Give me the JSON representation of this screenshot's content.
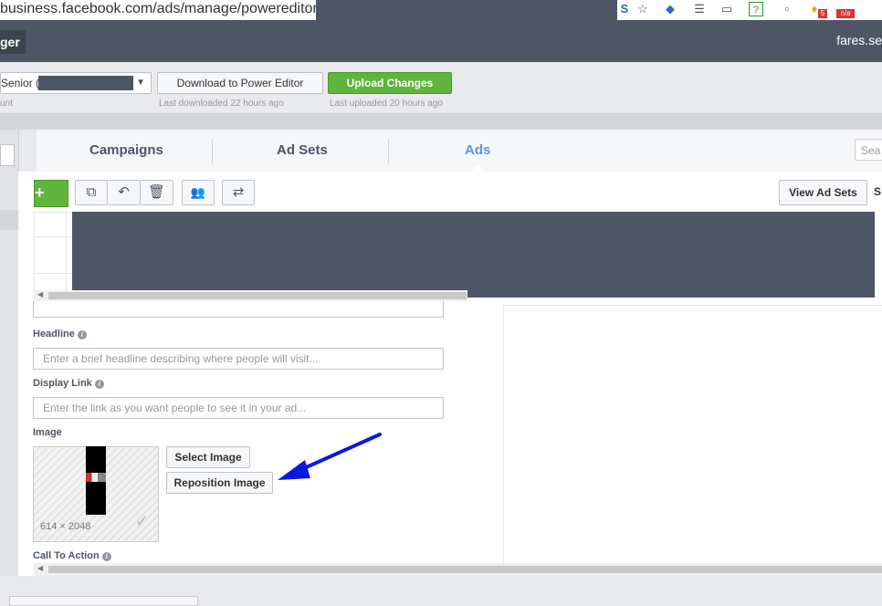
{
  "browser": {
    "url": "business.facebook.com/ads/manage/powereditor/",
    "toolbar_icons": [
      "s-icon",
      "star-icon",
      "puzzle-icon",
      "lines-icon",
      "minus-icon",
      "help-icon",
      "page-icon",
      "bulb-icon",
      "badge-icon"
    ],
    "badge_count": "5",
    "badge_na": "n/a"
  },
  "app": {
    "title_fragment": "ger",
    "user_fragment": "fares.se"
  },
  "toolbar": {
    "account_label": "Senior (",
    "account_sub": "unt",
    "download_label": "Download to Power Editor",
    "download_sub": "Last downloaded 22 hours ago",
    "upload_label": "Upload Changes",
    "upload_sub": "Last uploaded 20 hours ago"
  },
  "tabs": [
    {
      "label": "Campaigns"
    },
    {
      "label": "Ad Sets"
    },
    {
      "label": "Ads"
    }
  ],
  "search_fragment": "Sea",
  "actions": {
    "add_label": "+",
    "view_adsets_label": "View Ad Sets",
    "right_fragment": "S"
  },
  "form": {
    "headline_label": "Headline",
    "headline_placeholder": "Enter a brief headline describing where people will visit...",
    "display_link_label": "Display Link",
    "display_link_placeholder": "Enter the link as you want people to see it in your ad...",
    "image_label": "Image",
    "image_dims": "614 × 2048",
    "select_image_label": "Select Image",
    "reposition_image_label": "Reposition Image",
    "cta_label": "Call To Action"
  },
  "colors": {
    "header": "#4e5665",
    "accent_green": "#5fb53d",
    "tab_active": "#5890ff"
  }
}
